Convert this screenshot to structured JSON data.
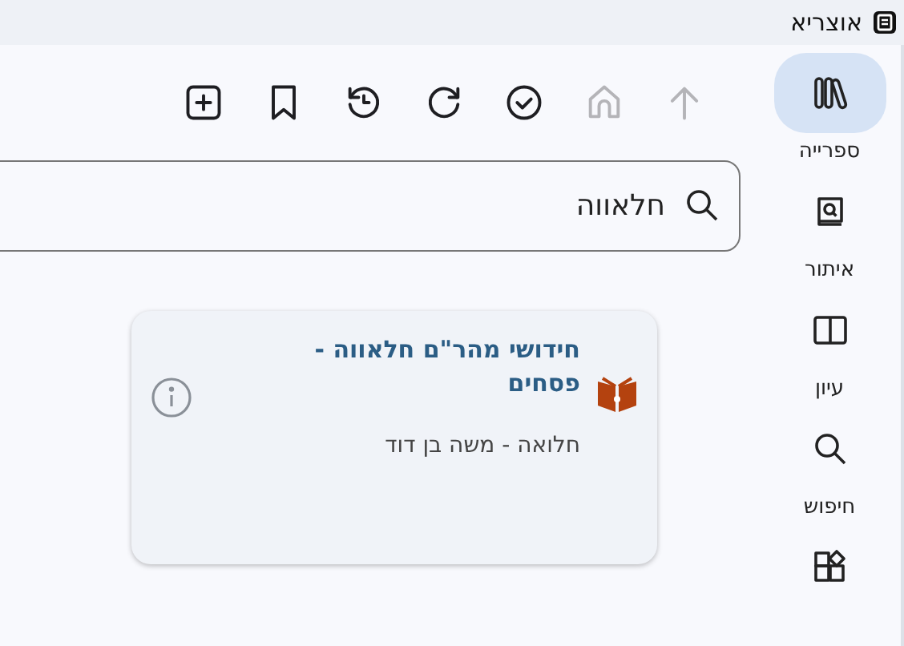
{
  "window": {
    "title": "אוצריא"
  },
  "toolbar": [
    {
      "disabled": true
    },
    {
      "disabled": true
    },
    {
      "disabled": false
    },
    {
      "disabled": false
    },
    {
      "disabled": false
    },
    {
      "disabled": false
    },
    {
      "disabled": false
    }
  ],
  "search": {
    "value": "חלאווה"
  },
  "results": [
    {
      "title": "חידושי מהר\"ם חלאווה - פסחים",
      "author": "חלואה - משה בן דוד"
    }
  ],
  "sidebar": {
    "items": [
      {
        "label": "ספרייה",
        "selected": true
      },
      {
        "label": "איתור",
        "selected": false
      },
      {
        "label": "עיון",
        "selected": false
      },
      {
        "label": "חיפוש",
        "selected": false
      },
      {
        "selected": false
      }
    ]
  }
}
